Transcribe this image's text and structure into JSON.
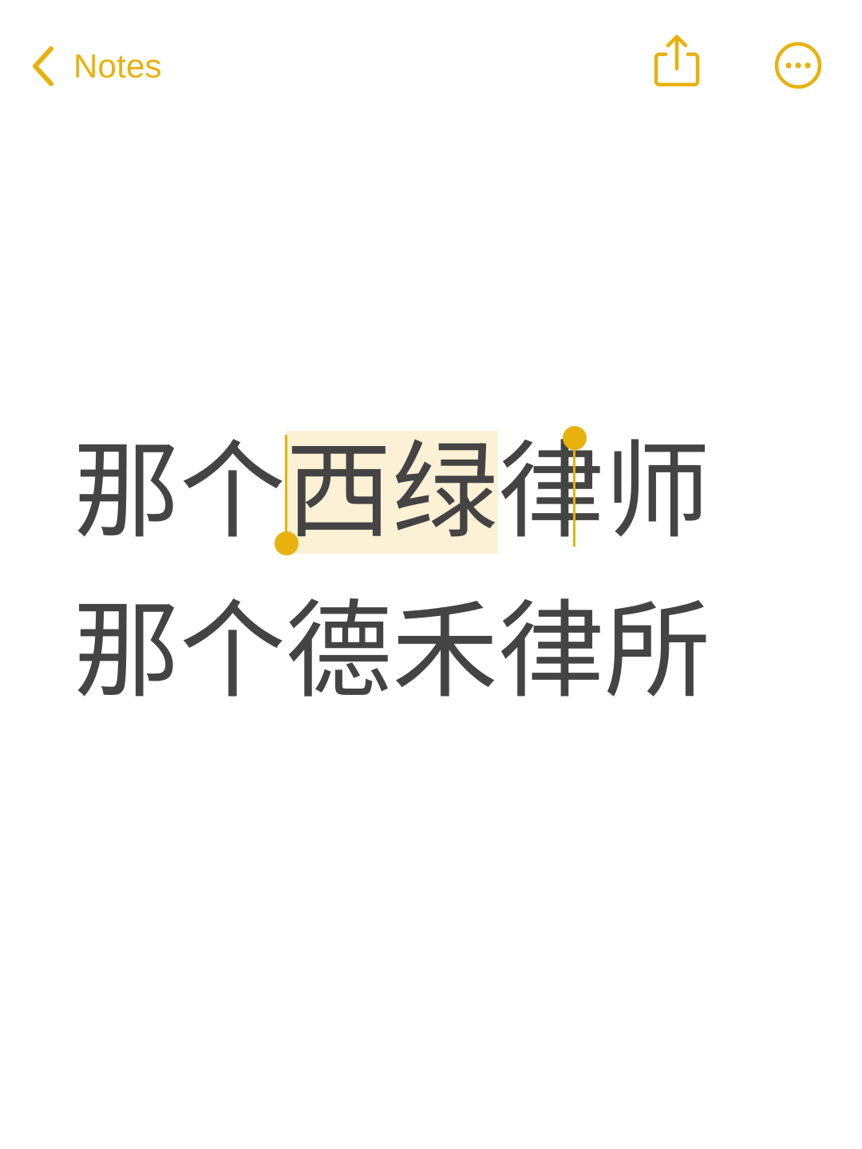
{
  "nav": {
    "back_label": "Notes",
    "back_icon": "chevron-left-icon",
    "share_icon": "share-icon",
    "more_icon": "ellipsis-circle-icon"
  },
  "colors": {
    "accent": "#e8b10e",
    "text": "#444444",
    "selection": "#fcf1d4",
    "background": "#ffffff"
  },
  "note": {
    "lines": [
      {
        "before": "那个",
        "selected": "西绿",
        "after": "律师"
      },
      {
        "text": "那个德禾律所"
      }
    ]
  }
}
